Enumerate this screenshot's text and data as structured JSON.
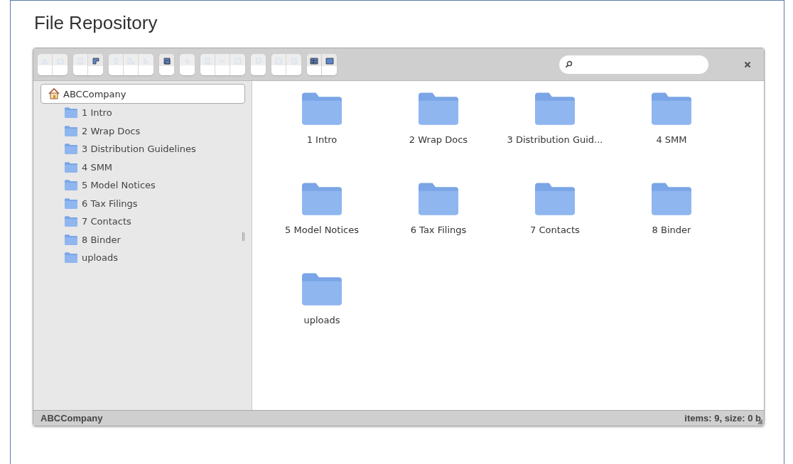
{
  "page": {
    "title": "File Repository"
  },
  "toolbar": {
    "groups": [
      {
        "buttons": [
          {
            "disabled": true
          },
          {
            "disabled": true
          }
        ]
      },
      {
        "buttons": [
          {
            "disabled": true
          },
          {
            "disabled": false
          }
        ]
      },
      {
        "buttons": [
          {
            "disabled": true
          },
          {
            "disabled": true
          },
          {
            "disabled": true
          }
        ]
      },
      {
        "buttons": [
          {
            "disabled": false
          }
        ]
      },
      {
        "buttons": [
          {
            "disabled": true
          }
        ]
      },
      {
        "buttons": [
          {
            "disabled": true
          },
          {
            "disabled": true
          },
          {
            "disabled": true
          }
        ]
      },
      {
        "buttons": [
          {
            "disabled": true
          }
        ]
      },
      {
        "buttons": [
          {
            "disabled": true
          },
          {
            "disabled": true
          }
        ]
      },
      {
        "buttons": [
          {
            "disabled": false
          },
          {
            "disabled": false
          }
        ]
      }
    ]
  },
  "tree": {
    "label": "ABCCompany",
    "selected": true,
    "children": [
      {
        "label": "1 Intro"
      },
      {
        "label": "2 Wrap Docs"
      },
      {
        "label": "3 Distribution Guidelines"
      },
      {
        "label": "4 SMM"
      },
      {
        "label": "5 Model Notices"
      },
      {
        "label": "6 Tax Filings"
      },
      {
        "label": "7 Contacts"
      },
      {
        "label": "8 Binder"
      },
      {
        "label": "uploads"
      }
    ]
  },
  "items": [
    {
      "name": "1 Intro"
    },
    {
      "name": "2 Wrap Docs"
    },
    {
      "name": "3 Distribution Guid..."
    },
    {
      "name": "4 SMM"
    },
    {
      "name": "5 Model Notices"
    },
    {
      "name": "6 Tax Filings"
    },
    {
      "name": "7 Contacts"
    },
    {
      "name": "8 Binder"
    },
    {
      "name": "uploads"
    }
  ],
  "status_bar": {
    "path": "ABCCompany",
    "summary": "items: 9, size: 0 b"
  }
}
